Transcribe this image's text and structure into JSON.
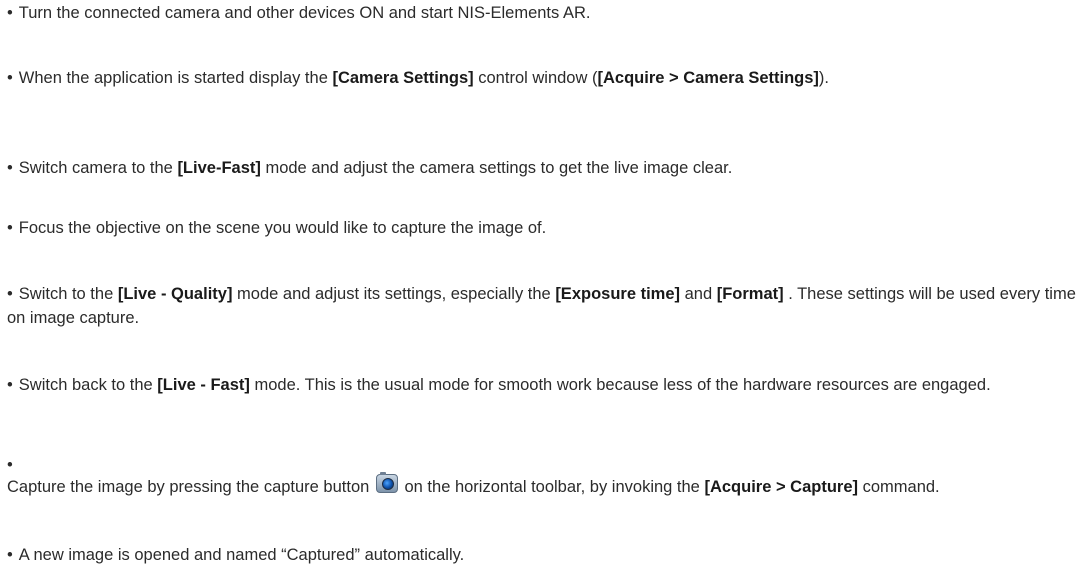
{
  "bullet": "•",
  "items": [
    {
      "text1": "Turn the connected camera and other devices ON and start NIS-Elements AR."
    },
    {
      "text1": "When the application is started display the ",
      "bold1": "[Camera Settings]",
      "text2": " control window (",
      "bold2": "[Acquire > Camera Settings]",
      "text3": ")."
    },
    {
      "text1": "Switch camera to the ",
      "bold1": "[Live-Fast]",
      "text2": " mode and adjust the camera settings to get the live image clear."
    },
    {
      "text1": "Focus the objective on the scene you would like to capture the image of."
    },
    {
      "text1": "Switch to the ",
      "bold1": "[Live - Quality]",
      "text2": " mode and adjust its settings, especially the ",
      "bold2": "[Exposure time]",
      "text3": " and ",
      "bold3": "[Format]",
      "text4": " . These settings will be used every time on image capture."
    },
    {
      "text1": "Switch back to the ",
      "bold1": "[Live - Fast]",
      "text2": " mode. This is the usual mode for smooth work because less of the hardware resources are engaged."
    },
    {
      "text1": "Capture the image by pressing the capture button ",
      "icon": "camera-capture-icon",
      "text2": " on the horizontal toolbar, by invoking the ",
      "bold1": "[Acquire > Capture]",
      "text3": " command."
    },
    {
      "text1": "A new image is opened and named “Captured” automatically."
    }
  ]
}
